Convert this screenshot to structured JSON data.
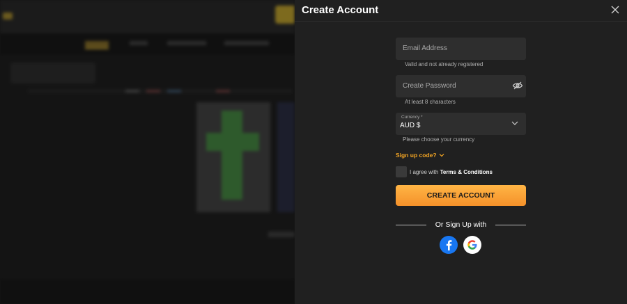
{
  "modal": {
    "title": "Create Account",
    "email_placeholder": "Email Address",
    "email_hint": "Valid and not already registered",
    "password_placeholder": "Create Password",
    "password_hint": "At least 8 characters",
    "currency_label": "Currency *",
    "currency_value": "AUD $",
    "currency_hint": "Please choose your currency",
    "signup_code": "Sign up code?",
    "agree_prefix": "I agree with ",
    "agree_link": "Terms & Conditions",
    "create_button": "CREATE ACCOUNT",
    "or_sign_up_with": "Or Sign Up with"
  },
  "icons": {
    "close": "close-icon",
    "eye": "eye-off-icon",
    "currency_chevron": "chevron-down-icon",
    "signup_chevron": "chevron-down-icon",
    "facebook": "facebook-icon",
    "google": "google-icon"
  },
  "colors": {
    "accent": "#f5a623",
    "button_gradient_top": "#ffb545",
    "button_gradient_bottom": "#f5912a",
    "panel_bg": "#202020",
    "field_bg": "#2e2e2e",
    "facebook": "#1877f2"
  }
}
